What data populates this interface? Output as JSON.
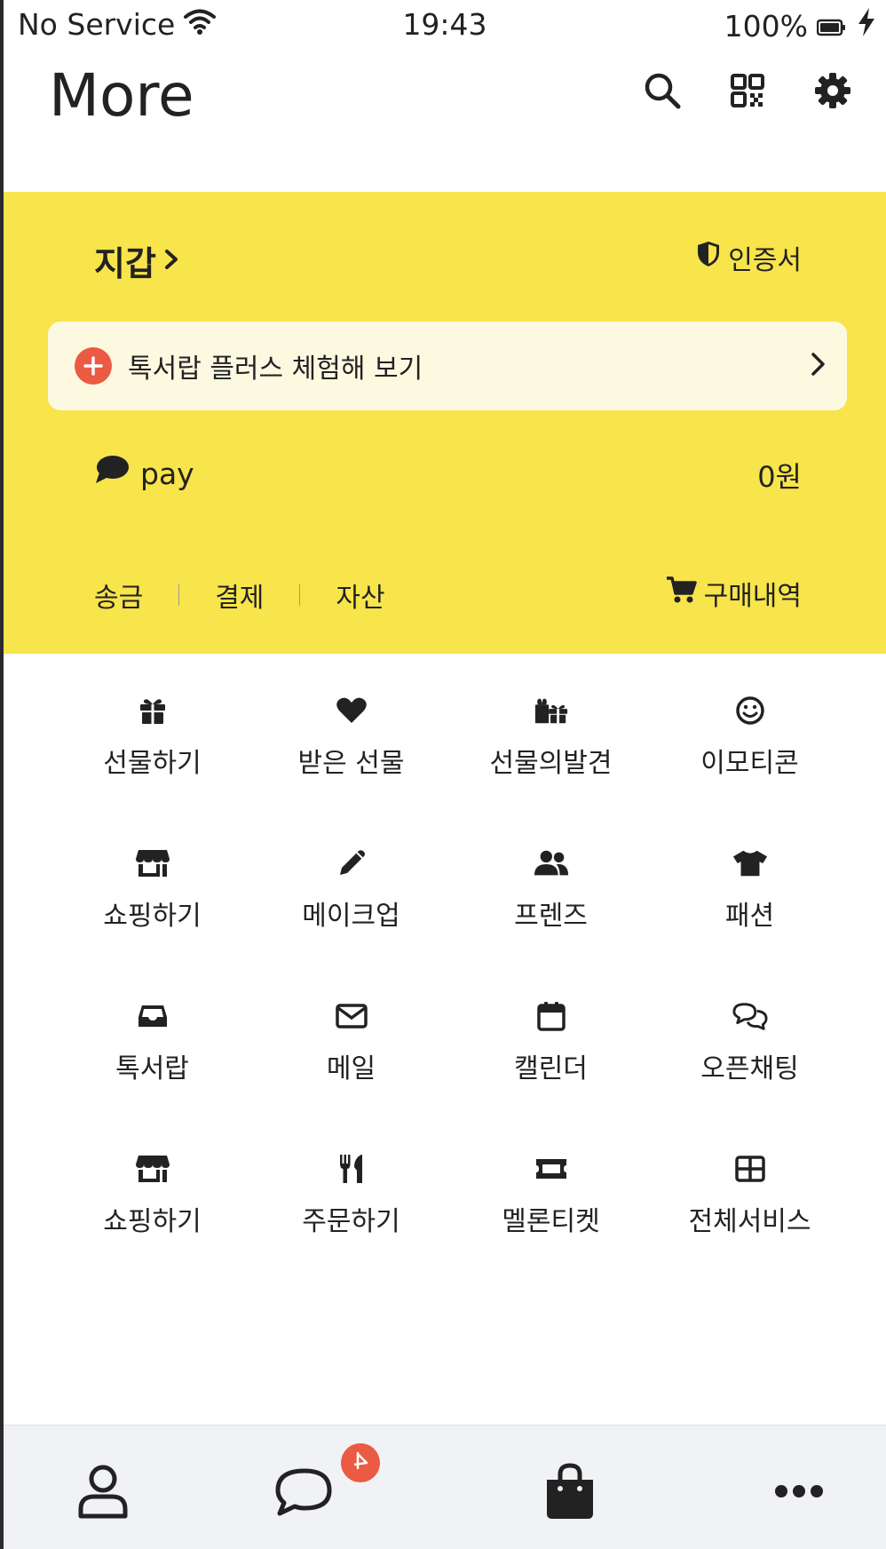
{
  "status_bar": {
    "carrier": "No Service",
    "time": "19:43",
    "battery": "100%",
    "wifi_icon": "wifi-icon",
    "battery_icon": "battery-icon",
    "charging_icon": "bolt-icon"
  },
  "header": {
    "title": "More",
    "icons": [
      "search-icon",
      "qr-code-icon",
      "gear-icon"
    ]
  },
  "wallet": {
    "title": "지갑",
    "certificate_label": "인증서",
    "promo_label": "톡서랍 플러스 체험해 보기",
    "pay_label": "pay",
    "pay_amount": "0원",
    "links": [
      "송금",
      "결제",
      "자산"
    ],
    "purchases_label": "구매내역",
    "background": "#f8e44b"
  },
  "services": [
    {
      "label": "선물하기",
      "icon": "gift-icon"
    },
    {
      "label": "받은 선물",
      "icon": "heart-icon"
    },
    {
      "label": "선물의발견",
      "icon": "gifts-icon"
    },
    {
      "label": "이모티콘",
      "icon": "smile-icon"
    },
    {
      "label": "쇼핑하기",
      "icon": "store-icon"
    },
    {
      "label": "메이크업",
      "icon": "pencil-icon"
    },
    {
      "label": "프렌즈",
      "icon": "users-icon"
    },
    {
      "label": "패션",
      "icon": "tshirt-icon"
    },
    {
      "label": "톡서랍",
      "icon": "inbox-icon"
    },
    {
      "label": "메일",
      "icon": "envelope-icon"
    },
    {
      "label": "캘린더",
      "icon": "calendar-icon"
    },
    {
      "label": "오픈채팅",
      "icon": "comments-icon"
    },
    {
      "label": "쇼핑하기",
      "icon": "store-icon"
    },
    {
      "label": "주문하기",
      "icon": "utensils-icon"
    },
    {
      "label": "멜론티켓",
      "icon": "ticket-icon"
    },
    {
      "label": "전체서비스",
      "icon": "grid-icon"
    }
  ],
  "bottom_nav": {
    "items": [
      "user-icon",
      "chat-icon",
      "shopping-bag-icon",
      "more-icon"
    ],
    "accent": "#eb5a43"
  }
}
